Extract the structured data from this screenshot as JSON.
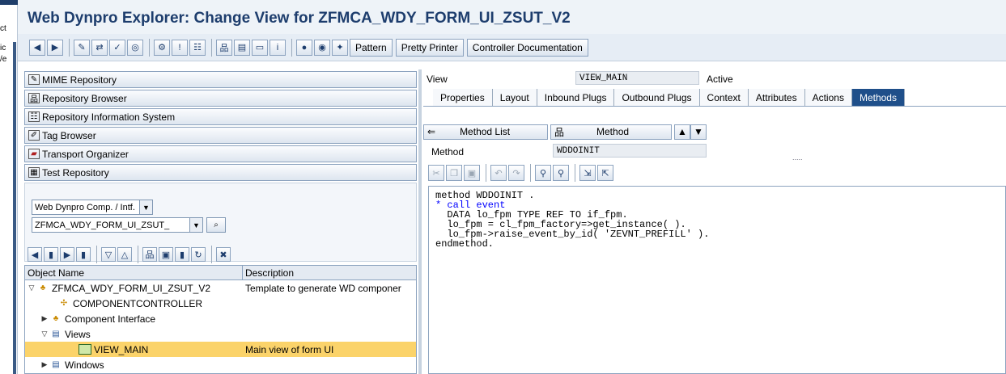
{
  "window": {
    "title": "Web Dynpro Explorer: Change View for ZFMCA_WDY_FORM_UI_ZSUT_V2"
  },
  "left_strip": {
    "fragments": [
      "ct",
      "ic",
      "/e"
    ]
  },
  "toolbar": {
    "pattern_label": "Pattern",
    "pretty_printer_label": "Pretty Printer",
    "controller_doc_label": "Controller Documentation"
  },
  "navigation": {
    "items": [
      {
        "label": "MIME Repository",
        "icon": "mime-icon"
      },
      {
        "label": "Repository Browser",
        "icon": "hierarchy-icon"
      },
      {
        "label": "Repository Information System",
        "icon": "info-system-icon"
      },
      {
        "label": "Tag Browser",
        "icon": "tag-icon"
      },
      {
        "label": "Transport Organizer",
        "icon": "truck-icon"
      },
      {
        "label": "Test Repository",
        "icon": "test-icon"
      }
    ]
  },
  "object_selector": {
    "type_value": "Web Dynpro Comp. / Intf.",
    "name_value": "ZFMCA_WDY_FORM_UI_ZSUT_"
  },
  "tree": {
    "col_object_name": "Object Name",
    "col_description": "Description",
    "rows": [
      {
        "label": "ZFMCA_WDY_FORM_UI_ZSUT_V2",
        "description": "Template to generate WD componer"
      },
      {
        "label": "COMPONENTCONTROLLER",
        "description": ""
      },
      {
        "label": "Component Interface",
        "description": ""
      },
      {
        "label": "Views",
        "description": ""
      },
      {
        "label": "VIEW_MAIN",
        "description": "Main view of form UI"
      },
      {
        "label": "Windows",
        "description": ""
      }
    ]
  },
  "view_header": {
    "view_label": "View",
    "view_name": "VIEW_MAIN",
    "status": "Active"
  },
  "tabs": [
    {
      "label": "Properties",
      "active": false
    },
    {
      "label": "Layout",
      "active": false
    },
    {
      "label": "Inbound Plugs",
      "active": false
    },
    {
      "label": "Outbound Plugs",
      "active": false
    },
    {
      "label": "Context",
      "active": false
    },
    {
      "label": "Attributes",
      "active": false
    },
    {
      "label": "Actions",
      "active": false
    },
    {
      "label": "Methods",
      "active": true
    }
  ],
  "method_bar": {
    "method_list_label": "Method List",
    "method_label": "Method",
    "method_field_label": "Method",
    "method_name": "WDDOINIT",
    "dots": "....."
  },
  "code": {
    "lines": [
      "method WDDOINIT .",
      "* call event",
      "  DATA lo_fpm TYPE REF TO if_fpm.",
      "  lo_fpm = cl_fpm_factory=>get_instance( ).",
      "  lo_fpm->raise_event_by_id( 'ZEVNT_PREFILL' ).",
      "endmethod."
    ]
  },
  "colors": {
    "title": "#1d3d6d",
    "active_tab": "#1f4f8a",
    "selected_row": "#fbd36a",
    "comment": "#0000ff"
  }
}
